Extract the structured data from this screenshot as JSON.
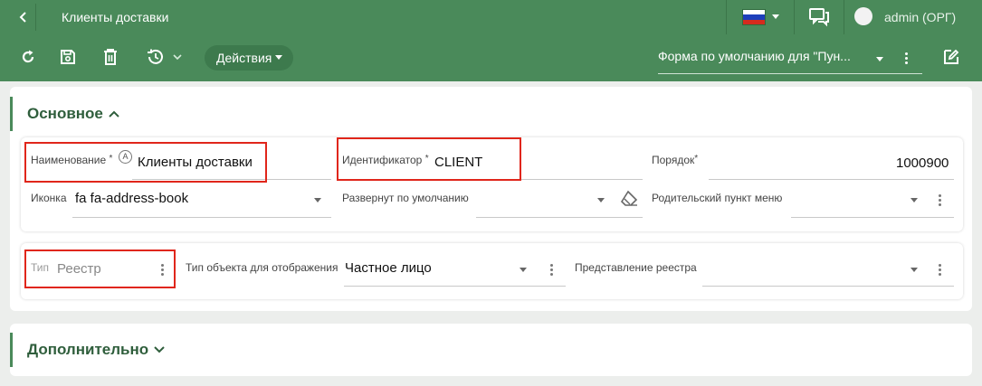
{
  "header": {
    "title": "Клиенты доставки",
    "user": "admin (ОРГ)"
  },
  "toolbar": {
    "actions_label": "Действия",
    "form_select": "Форма по умолчанию для \"Пун..."
  },
  "sections": {
    "main_title": "Основное",
    "extra_title": "Дополнительно"
  },
  "fields": {
    "name_label": "Наименование",
    "name_value": "Клиенты доставки",
    "identifier_label": "Идентификатор",
    "identifier_value": "CLIENT",
    "order_label": "Порядок",
    "order_value": "1000900",
    "icon_label": "Иконка",
    "icon_value": "fa fa-address-book",
    "expanded_label": "Развернут по умолчанию",
    "parent_label": "Родительский пункт меню",
    "type_label": "Тип",
    "type_value": "Реестр",
    "object_type_label": "Тип объекта для отображения",
    "object_type_value": "Частное лицо",
    "registry_view_label": "Представление реестра",
    "required_mark": "*",
    "auto_mark": "A"
  },
  "colors": {
    "brand": "#4a8a5a",
    "highlight": "#e0261b"
  }
}
